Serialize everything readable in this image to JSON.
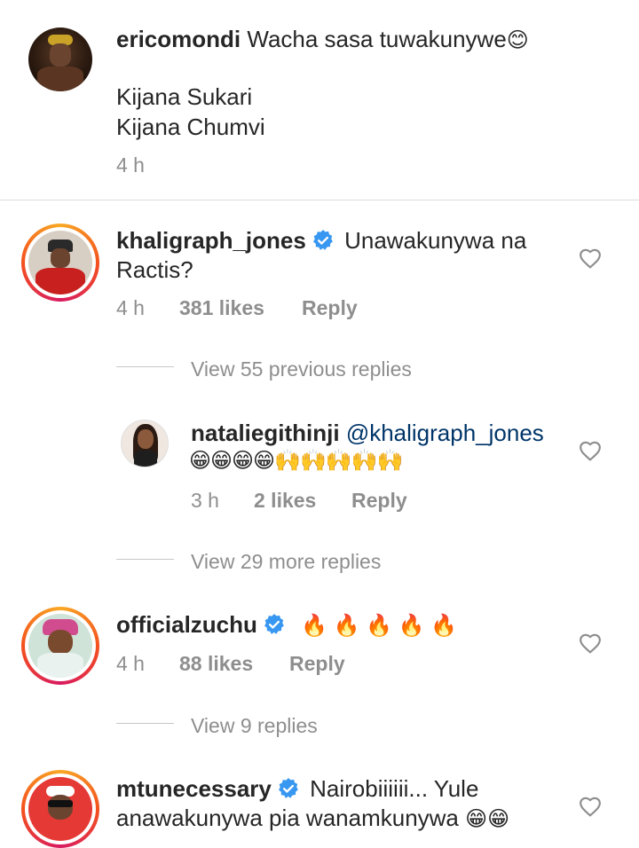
{
  "caption": {
    "username": "ericomondi",
    "text_line1": "Wacha sasa tuwakunywe",
    "emoji_line1": "😊",
    "line2": "Kijana Sukari",
    "line3": "Kijana Chumvi",
    "time": "4 h"
  },
  "comments": [
    {
      "username": "khaligraph_jones",
      "text": "Unawakunywa na",
      "text2": "Ractis?",
      "time": "4 h",
      "likes": "381 likes",
      "reply": "Reply",
      "view_replies": "View 55 previous replies"
    },
    {
      "username": "nataliegithinji",
      "mention": "@khaligraph_jones",
      "emojis": "😁😁😁😁🙌🙌🙌🙌🙌",
      "time": "3 h",
      "likes": "2 likes",
      "reply": "Reply",
      "view_replies": "View 29 more replies"
    },
    {
      "username": "officialzuchu",
      "emojis": "🔥 🔥 🔥 🔥 🔥",
      "time": "4 h",
      "likes": "88 likes",
      "reply": "Reply",
      "view_replies": "View 9 replies"
    },
    {
      "username": "mtunecessary",
      "text": "Nairobiiiiii... Yule",
      "text2": "anawakunywa pia wanamkunywa",
      "emojis": "😁😁"
    }
  ],
  "colors": {
    "verified": "#3897f0",
    "meta_gray": "#8e8e8e",
    "mention": "#003569"
  }
}
